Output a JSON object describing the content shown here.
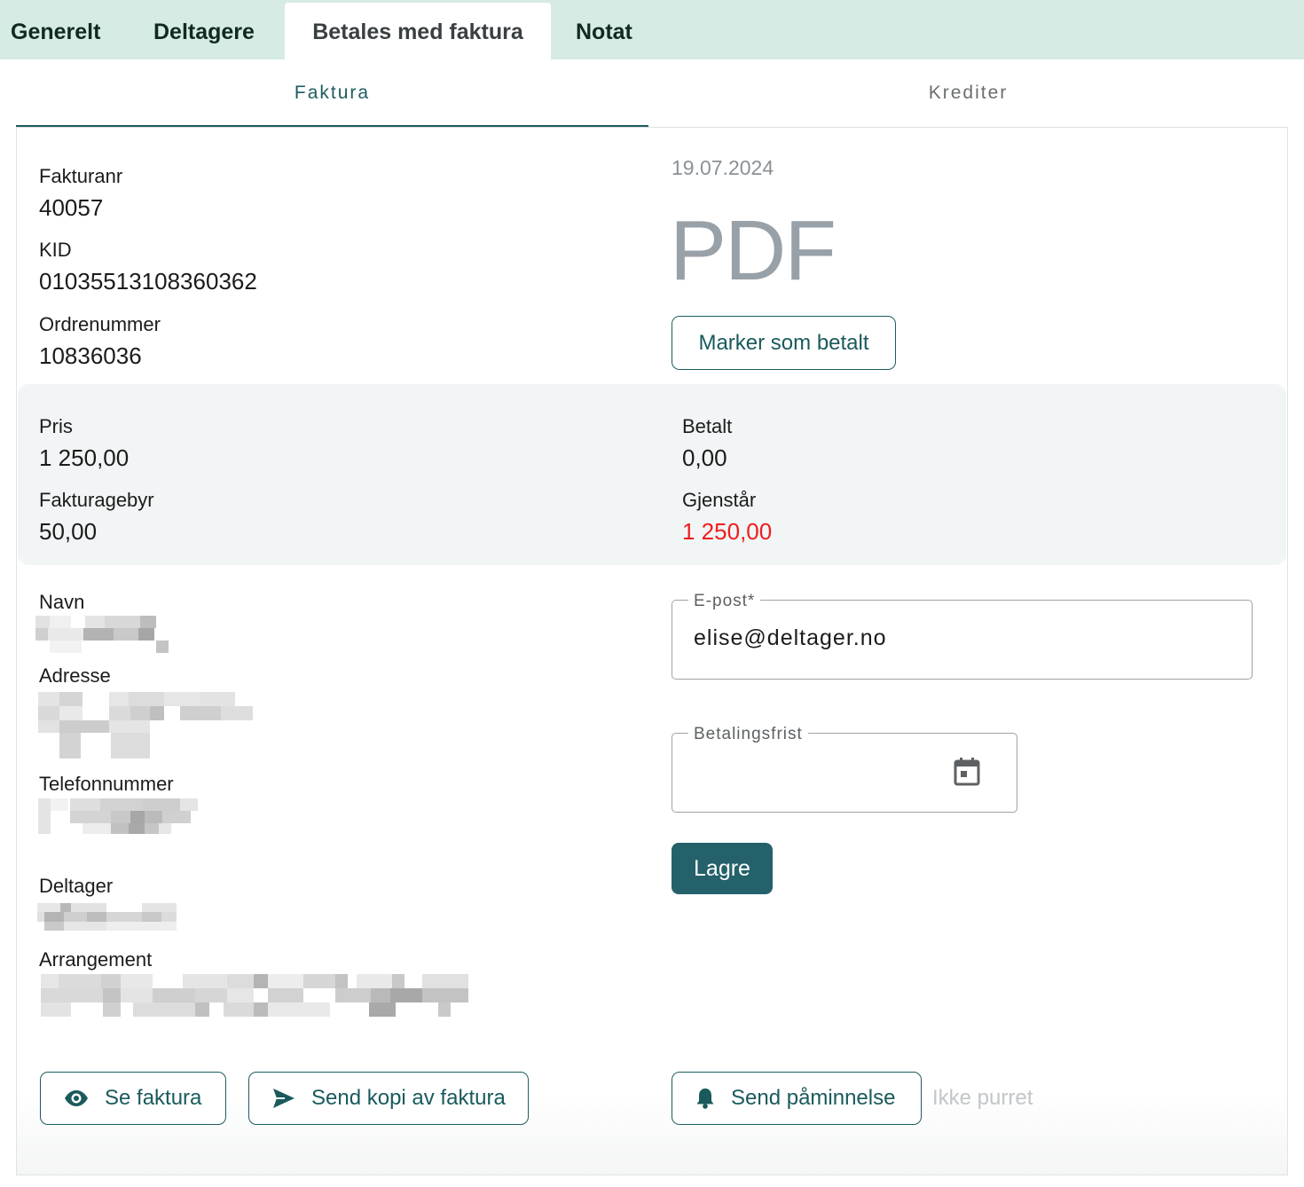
{
  "top_tabs": [
    {
      "label": "Generelt",
      "active": false
    },
    {
      "label": "Deltagere",
      "active": false
    },
    {
      "label": "Betales med faktura",
      "active": true
    },
    {
      "label": "Notat",
      "active": false
    }
  ],
  "sub_tabs": [
    {
      "label": "Faktura",
      "active": true
    },
    {
      "label": "Krediter",
      "active": false
    }
  ],
  "invoice": {
    "fakturanr_label": "Fakturanr",
    "fakturanr_value": "40057",
    "kid_label": "KID",
    "kid_value": "01035513108360362",
    "ordrenummer_label": "Ordrenummer",
    "ordrenummer_value": "10836036",
    "date": "19.07.2024",
    "pdf_label": "PDF",
    "mark_paid_label": "Marker som betalt"
  },
  "summary": {
    "pris_label": "Pris",
    "pris_value": "1 250,00",
    "fakturagebyr_label": "Fakturagebyr",
    "fakturagebyr_value": "50,00",
    "betalt_label": "Betalt",
    "betalt_value": "0,00",
    "gjenstar_label": "Gjenstår",
    "gjenstar_value": "1 250,00",
    "gjenstar_color": "#ef1d1d"
  },
  "customer": {
    "navn_label": "Navn",
    "adresse_label": "Adresse",
    "telefon_label": "Telefonnummer",
    "deltager_label": "Deltager",
    "arrangement_label": "Arrangement"
  },
  "form": {
    "email_label": "E-post*",
    "email_value": "elise@deltager.no",
    "due_label": "Betalingsfrist",
    "due_value": "",
    "save_label": "Lagre"
  },
  "actions": {
    "view_label": "Se faktura",
    "view_icon": "eye-icon",
    "send_copy_label": "Send kopi av faktura",
    "send_copy_icon": "send-icon",
    "reminder_label": "Send påminnelse",
    "reminder_icon": "bell-icon",
    "reminder_status": "Ikke purret"
  },
  "colors": {
    "accent": "#1d5d5f",
    "primary_button": "#24616a",
    "top_bar": "#d6ebe3",
    "summary_bg": "#f1f5f5"
  }
}
